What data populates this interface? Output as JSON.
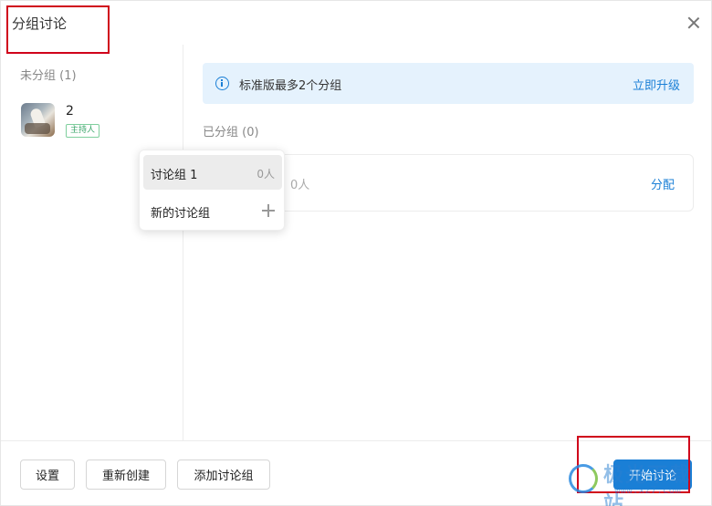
{
  "dialog": {
    "title": "分组讨论"
  },
  "left_panel": {
    "unassigned_label": "未分组 (1)",
    "members": [
      {
        "name": "2",
        "badge": "主持人"
      }
    ]
  },
  "main": {
    "info_text": "标准版最多2个分组",
    "upgrade_label": "立即升级",
    "assigned_label": "已分组 (0)",
    "group_card": {
      "count": "0人",
      "assign_label": "分配"
    }
  },
  "popup": {
    "items": [
      {
        "label": "讨论组 1",
        "count": "0人"
      },
      {
        "label": "新的讨论组"
      }
    ]
  },
  "footer": {
    "settings_label": "设置",
    "recreate_label": "重新创建",
    "add_group_label": "添加讨论组",
    "start_label": "开始讨论"
  },
  "watermark": {
    "text": "极光下载站",
    "url": "www.xz7.com"
  },
  "colors": {
    "accent": "#1a7fd6",
    "info_bg": "#e5f2fd",
    "highlight": "#d0021b",
    "badge": "#3aa56a"
  }
}
